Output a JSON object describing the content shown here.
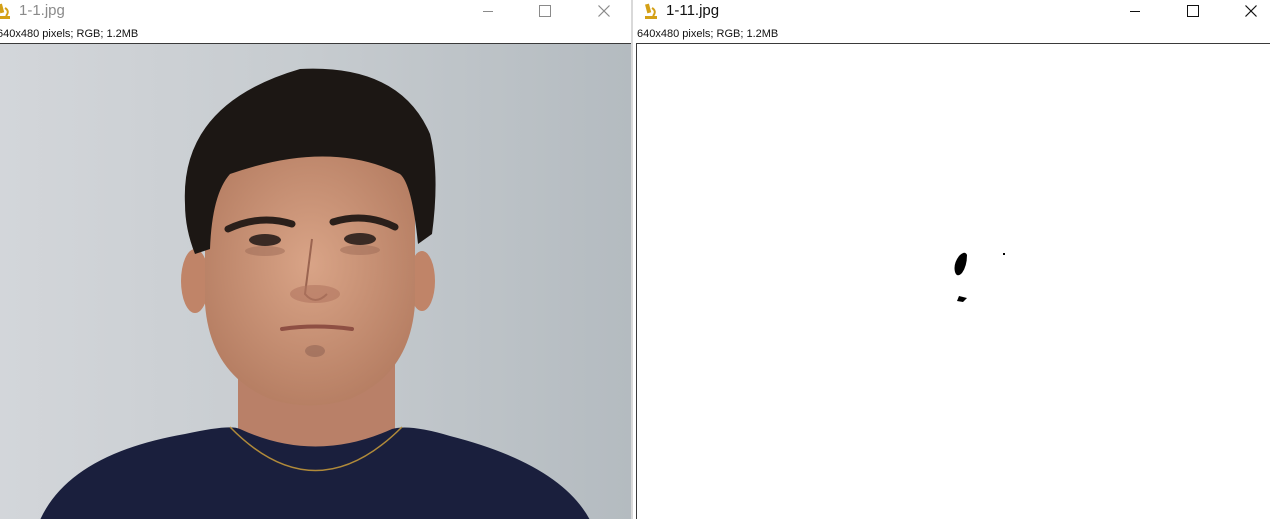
{
  "windows": [
    {
      "title": "1-1.jpg",
      "info": "640x480 pixels; RGB; 1.2MB",
      "icon": "microscope-icon",
      "active": false
    },
    {
      "title": "1-11.jpg",
      "info": "640x480 pixels; RGB; 1.2MB",
      "icon": "microscope-icon",
      "active": true
    }
  ],
  "colors": {
    "icon_accent": "#d4a017",
    "background_wall": "#c3c8cc",
    "shirt": "#1a1f3d",
    "hair": "#1c1714",
    "skin": "#c99277",
    "binary_bg": "#ffffff",
    "binary_fg": "#000000"
  }
}
